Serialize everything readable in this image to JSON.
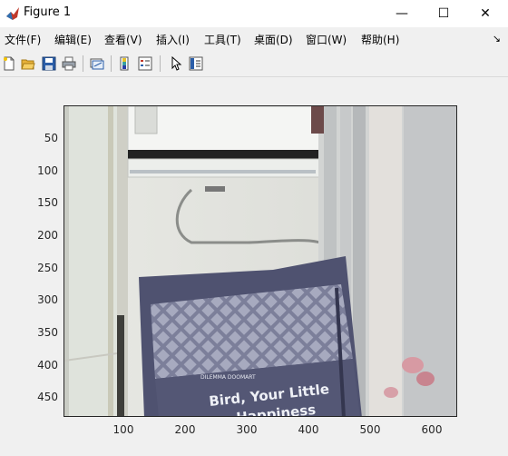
{
  "window": {
    "title": "Figure 1",
    "minimize": "—",
    "maximize": "☐",
    "close": "✕"
  },
  "menu": {
    "items": [
      "文件(F)",
      "编辑(E)",
      "查看(V)",
      "插入(I)",
      "工具(T)",
      "桌面(D)",
      "窗口(W)",
      "帮助(H)"
    ],
    "overflow": "↘"
  },
  "toolbar": {
    "icons": [
      "new-figure-icon",
      "open-file-icon",
      "save-icon",
      "print-icon",
      "link-plot-icon",
      "colorbar-icon",
      "legend-icon",
      "pointer-icon",
      "property-editor-icon"
    ]
  },
  "axes": {
    "yticks": [
      "50",
      "100",
      "150",
      "200",
      "250",
      "300",
      "350",
      "400",
      "450"
    ],
    "xticks": [
      "100",
      "200",
      "300",
      "400",
      "500",
      "600"
    ]
  },
  "image": {
    "bag_text_line1": "Bird, Your Little",
    "bag_text_line2": "Happiness",
    "bag_brand": "DILEMMA DOOMART"
  }
}
